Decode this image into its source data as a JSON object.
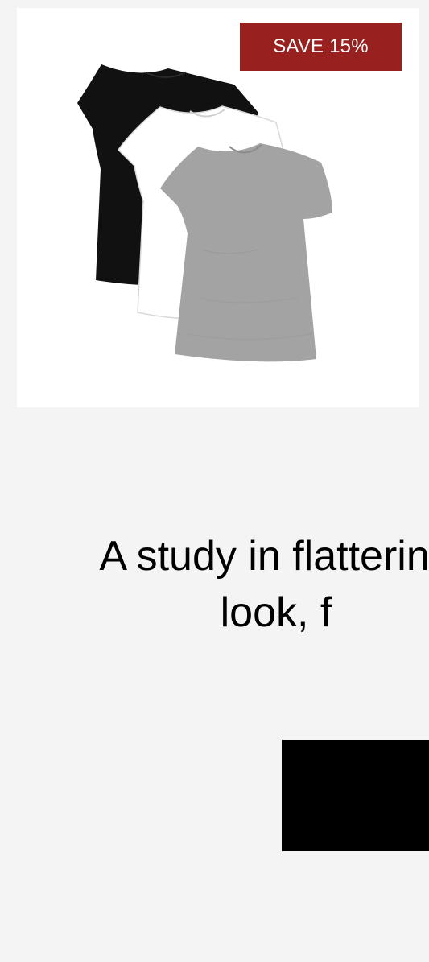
{
  "product": {
    "badge": "SAVE 15%",
    "image_alt": "black, white and heather grey fitted crew neck t-shirts",
    "badge_color": "#98201f"
  },
  "hero": {
    "tagline": "A study in flattering look, f"
  },
  "cta": {
    "label": ""
  },
  "colors": {
    "page_background": "#f4f4f4",
    "card_background": "#ffffff",
    "shirt_black": "#111111",
    "shirt_white": "#ffffff",
    "shirt_grey": "#a3a3a3"
  }
}
